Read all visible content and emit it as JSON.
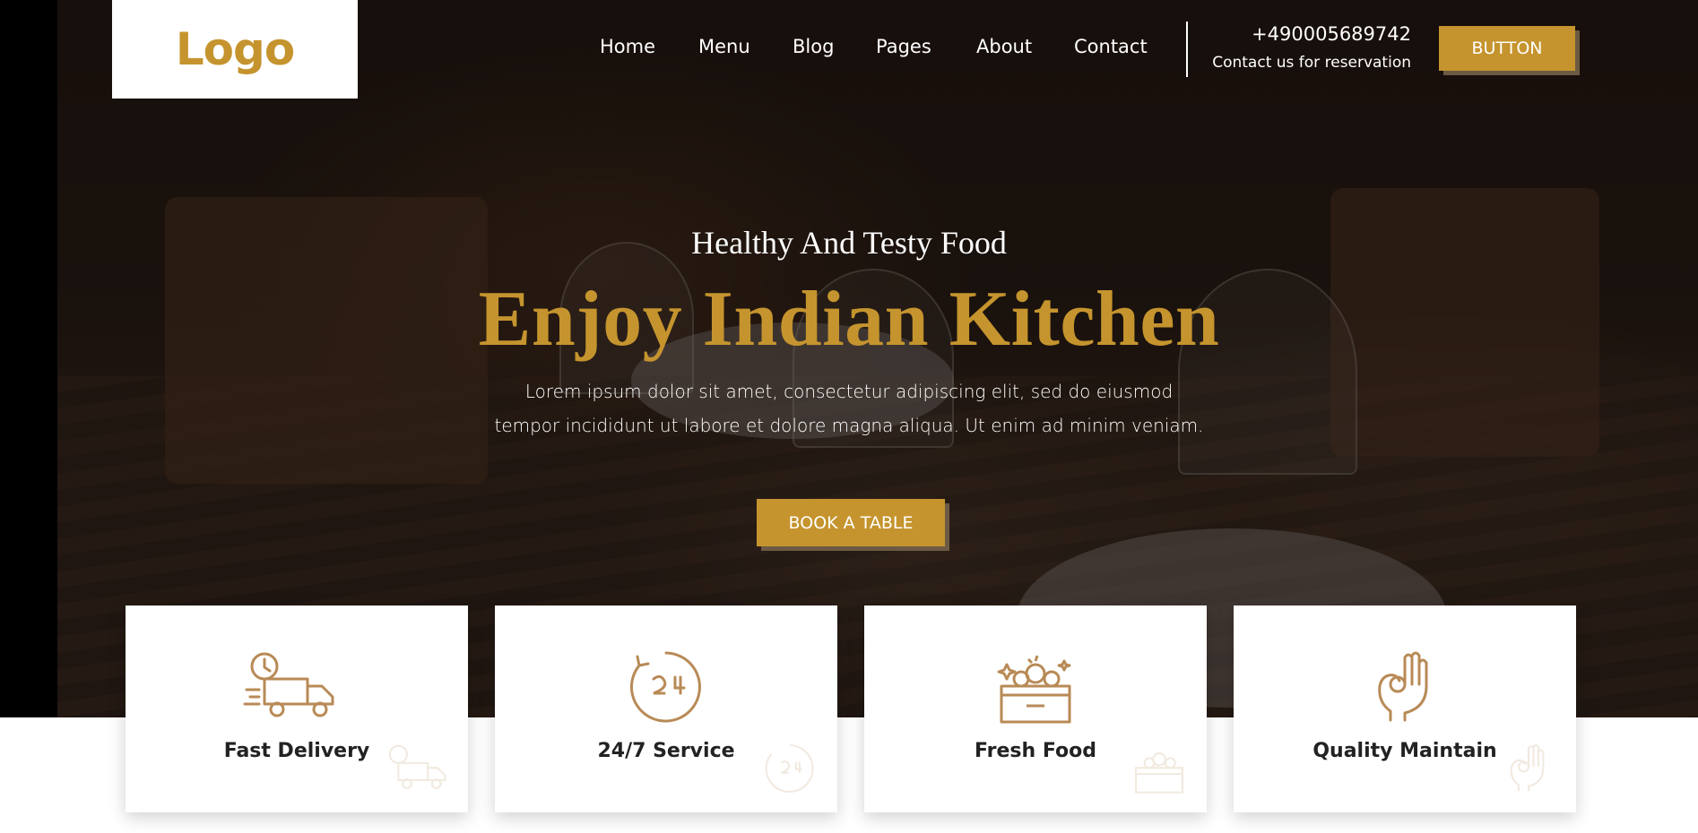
{
  "header": {
    "logo": "Logo",
    "nav": [
      "Home",
      "Menu",
      "Blog",
      "Pages",
      "About",
      "Contact"
    ],
    "phone": "+490005689742",
    "reservation": "Contact us for reservation",
    "button": "BUTTON"
  },
  "hero": {
    "subtitle": "Healthy And Testy Food",
    "title": "Enjoy Indian Kitchen",
    "description": "Lorem ipsum dolor sit amet, consectetur adipiscing elit, sed do eiusmod tempor incididunt ut labore et dolore magna aliqua. Ut enim ad minim veniam.",
    "cta": "BOOK A TABLE"
  },
  "features": [
    {
      "title": "Fast Delivery",
      "icon": "delivery-truck-icon"
    },
    {
      "title": "24/7 Service",
      "icon": "clock-24-icon"
    },
    {
      "title": "Fresh Food",
      "icon": "fresh-food-basket-icon"
    },
    {
      "title": "Quality Maintain",
      "icon": "ok-hand-icon"
    }
  ],
  "colors": {
    "accent": "#c5942e",
    "icon": "#b88a56",
    "text_dark": "#222222",
    "white": "#ffffff"
  }
}
